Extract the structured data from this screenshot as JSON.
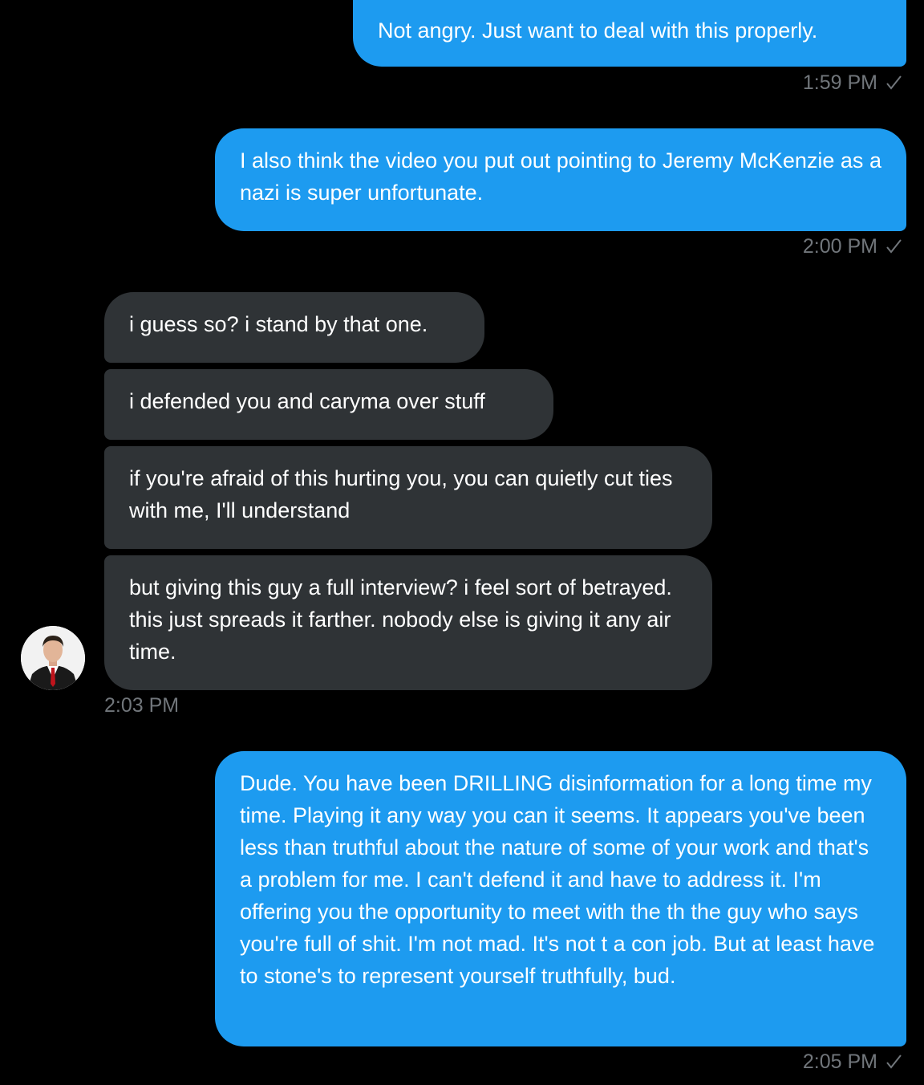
{
  "colors": {
    "background": "#000000",
    "outgoing_bubble": "#1d9bf0",
    "incoming_bubble": "#2f3336",
    "timestamp": "#71767b"
  },
  "messages": [
    {
      "dir": "out",
      "text": "Not angry.  Just want to deal with this properly.",
      "time": "1:59 PM",
      "status_icon": "check-icon"
    },
    {
      "dir": "out",
      "text": "I also think the video you put out pointing to Jeremy McKenzie as a nazi is super unfortunate.",
      "time": "2:00 PM",
      "status_icon": "check-icon"
    },
    {
      "dir": "in",
      "text": "i guess so? i stand by that one."
    },
    {
      "dir": "in",
      "text": "i defended you and caryma over stuff"
    },
    {
      "dir": "in",
      "text": "if you're afraid of this hurting you, you can quietly cut ties with me, I'll understand"
    },
    {
      "dir": "in",
      "text": "but giving this guy a full interview? i feel sort of betrayed. this just spreads it farther. nobody else is giving it any air time.",
      "time": "2:03 PM"
    },
    {
      "dir": "out",
      "text": "Dude. You have been DRILLING disinformation for a long time my time. Playing it any way you can it seems.  It appears you've been less than truthful about the nature of some of your work and that's a problem for me.  I can't defend it and have to address it.  I'm offering you the opportunity to meet with the th the guy who says you're full of shit. I'm not mad.  It's not t a con job.  But at least have to stone's to represent yourself truthfully, bud.",
      "time": "2:05 PM",
      "status_icon": "check-icon"
    }
  ]
}
